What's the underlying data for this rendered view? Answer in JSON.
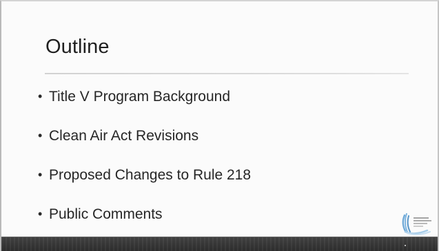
{
  "slide": {
    "title": "Outline",
    "bullets": [
      "Title V Program Background",
      "Clean Air Act Revisions",
      "Proposed Changes to Rule 218",
      "Public Comments"
    ]
  },
  "logo": {
    "icon": "agency-logo-icon"
  },
  "colors": {
    "title": "#1f1f1f",
    "text": "#262626",
    "divider": "#d6d6d6",
    "footer": "#333333",
    "logo_blue": "#6ea9d8"
  }
}
